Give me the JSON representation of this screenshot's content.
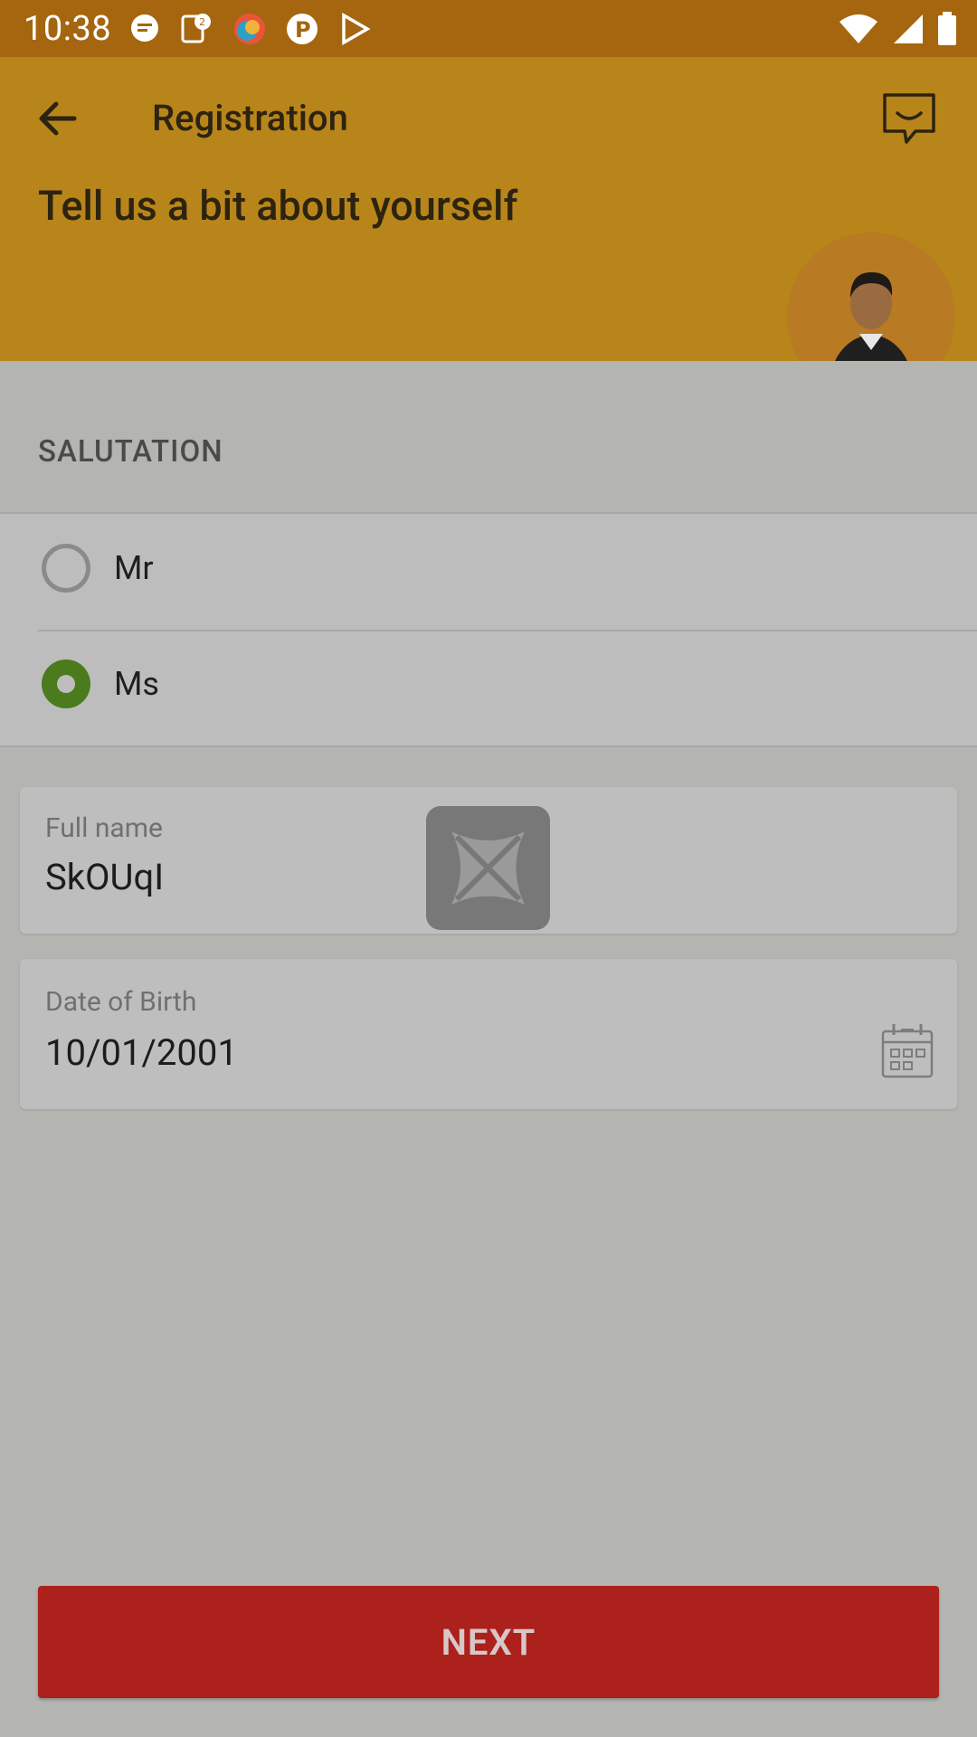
{
  "status_bar": {
    "time": "10:38",
    "notification_icons": [
      "message-bubble-icon",
      "notification-badge-icon",
      "browser-icon",
      "p-app-icon",
      "play-store-icon"
    ],
    "system_icons": [
      "wifi-icon",
      "signal-icon",
      "battery-icon"
    ]
  },
  "header": {
    "title": "Registration",
    "subtitle": "Tell us a bit about yourself",
    "back_icon": "arrow-left-icon",
    "chat_icon": "chat-bubble-icon",
    "avatar": "person-avatar"
  },
  "salutation": {
    "label": "SALUTATION",
    "options": [
      {
        "label": "Mr",
        "selected": false
      },
      {
        "label": "Ms",
        "selected": true
      }
    ]
  },
  "form": {
    "full_name": {
      "label": "Full name",
      "value": "SkOUqI"
    },
    "dob": {
      "label": "Date of Birth",
      "value": "10/01/2001"
    }
  },
  "actions": {
    "next_label": "NEXT"
  },
  "colors": {
    "header_bg": "#b8851a",
    "status_bar_bg": "#a5660f",
    "radio_selected": "#4b7b1c",
    "next_button": "#ac211c"
  }
}
